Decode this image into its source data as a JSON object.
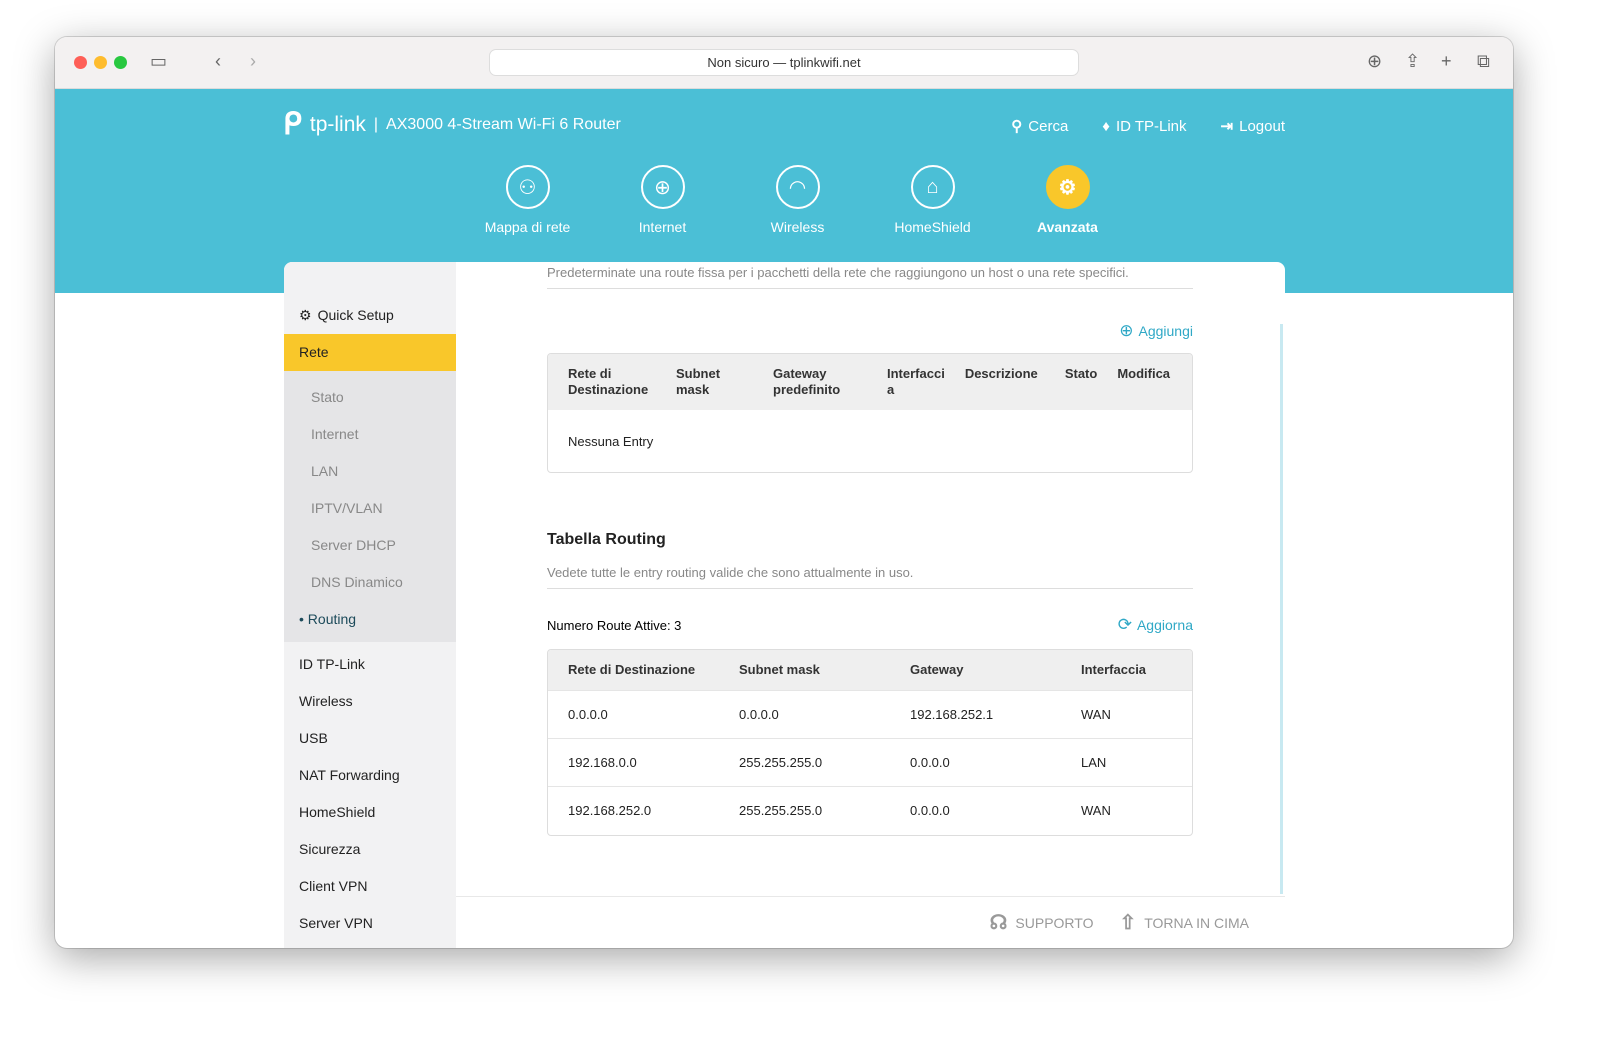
{
  "browser": {
    "url": "Non sicuro — tplinkwifi.net"
  },
  "header": {
    "brand": "tp-link",
    "model": "AX3000 4-Stream Wi-Fi 6 Router",
    "links": [
      "Cerca",
      "ID TP-Link",
      "Logout"
    ],
    "nav": [
      {
        "label": "Mappa di rete",
        "icon": "network-map-icon"
      },
      {
        "label": "Internet",
        "icon": "globe-icon"
      },
      {
        "label": "Wireless",
        "icon": "wifi-icon"
      },
      {
        "label": "HomeShield",
        "icon": "homeshield-icon"
      },
      {
        "label": "Avanzata",
        "icon": "gear-icon"
      }
    ]
  },
  "sidebar": {
    "quick_setup": "Quick Setup",
    "rete": "Rete",
    "sub": [
      "Stato",
      "Internet",
      "LAN",
      "IPTV/VLAN",
      "Server DHCP",
      "DNS Dinamico",
      "Routing"
    ],
    "items": [
      "ID TP-Link",
      "Wireless",
      "USB",
      "NAT Forwarding",
      "HomeShield",
      "Sicurezza",
      "Client VPN",
      "Server VPN"
    ]
  },
  "static": {
    "desc": "Predeterminate una route fissa per i pacchetti della rete che raggiungono un host o una rete specifici.",
    "add": "Aggiungi",
    "headers": [
      "Rete di Destinazione",
      "Subnet mask",
      "Gateway predefinito",
      "Interfaccia",
      "Descrizione",
      "Stato",
      "Modifica"
    ],
    "empty": "Nessuna Entry"
  },
  "routing": {
    "title": "Tabella Routing",
    "desc": "Vedete tutte le entry routing valide che sono attualmente in uso.",
    "count": "Numero Route Attive: 3",
    "refresh": "Aggiorna",
    "headers": [
      "Rete di Destinazione",
      "Subnet mask",
      "Gateway",
      "Interfaccia"
    ],
    "rows": [
      [
        "0.0.0.0",
        "0.0.0.0",
        "192.168.252.1",
        "WAN"
      ],
      [
        "192.168.0.0",
        "255.255.255.0",
        "0.0.0.0",
        "LAN"
      ],
      [
        "192.168.252.0",
        "255.255.255.0",
        "0.0.0.0",
        "WAN"
      ]
    ]
  },
  "footer": {
    "support": "SUPPORTO",
    "top": "TORNA IN CIMA"
  },
  "colors": {
    "header": "#4bbfd6",
    "accent": "#f9c72a",
    "link": "#2fa8c6"
  }
}
